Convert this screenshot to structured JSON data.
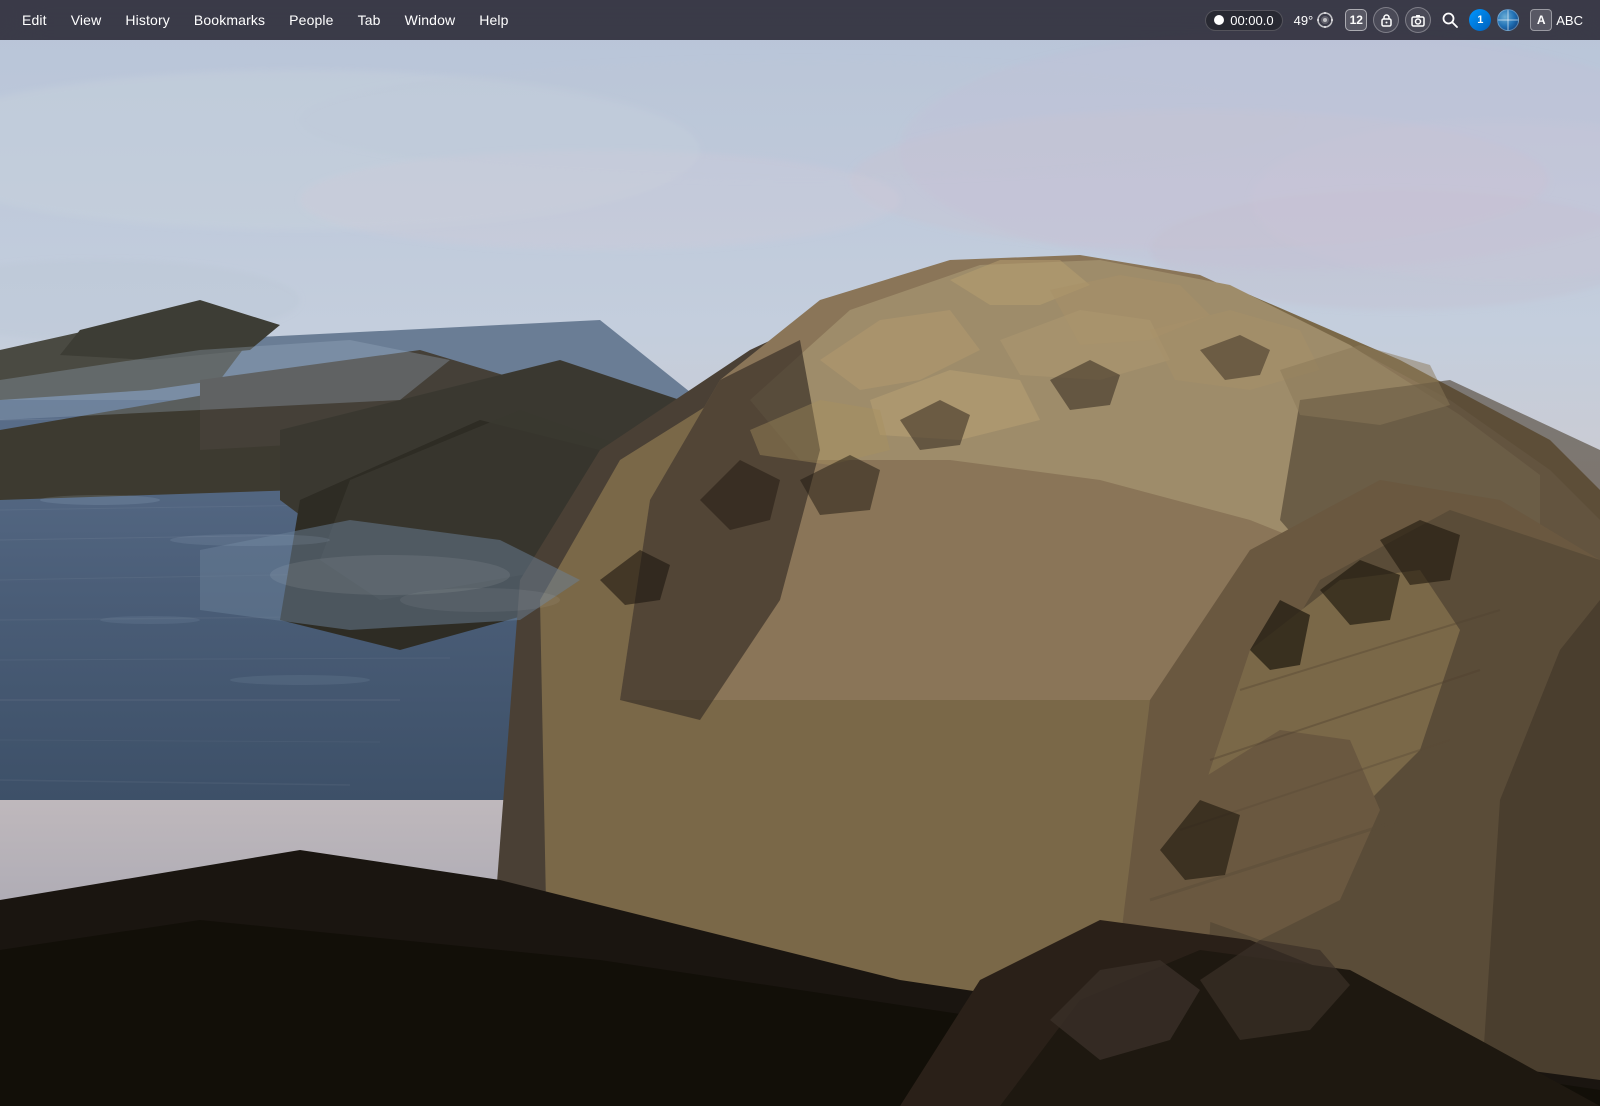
{
  "menubar": {
    "items_left": [
      {
        "id": "edit",
        "label": "Edit"
      },
      {
        "id": "view",
        "label": "View"
      },
      {
        "id": "history",
        "label": "History"
      },
      {
        "id": "bookmarks",
        "label": "Bookmarks"
      },
      {
        "id": "people",
        "label": "People"
      },
      {
        "id": "tab",
        "label": "Tab"
      },
      {
        "id": "window",
        "label": "Window"
      },
      {
        "id": "help",
        "label": "Help"
      }
    ],
    "status_items": {
      "recording_time": "00:00.0",
      "temperature": "49°",
      "tab_count": "12",
      "search_icon": "🔍",
      "onepassword_label": "1",
      "text_input_label": "ABC"
    }
  },
  "wallpaper": {
    "description": "macOS Catalina - coastal cliff landscape with ocean"
  }
}
